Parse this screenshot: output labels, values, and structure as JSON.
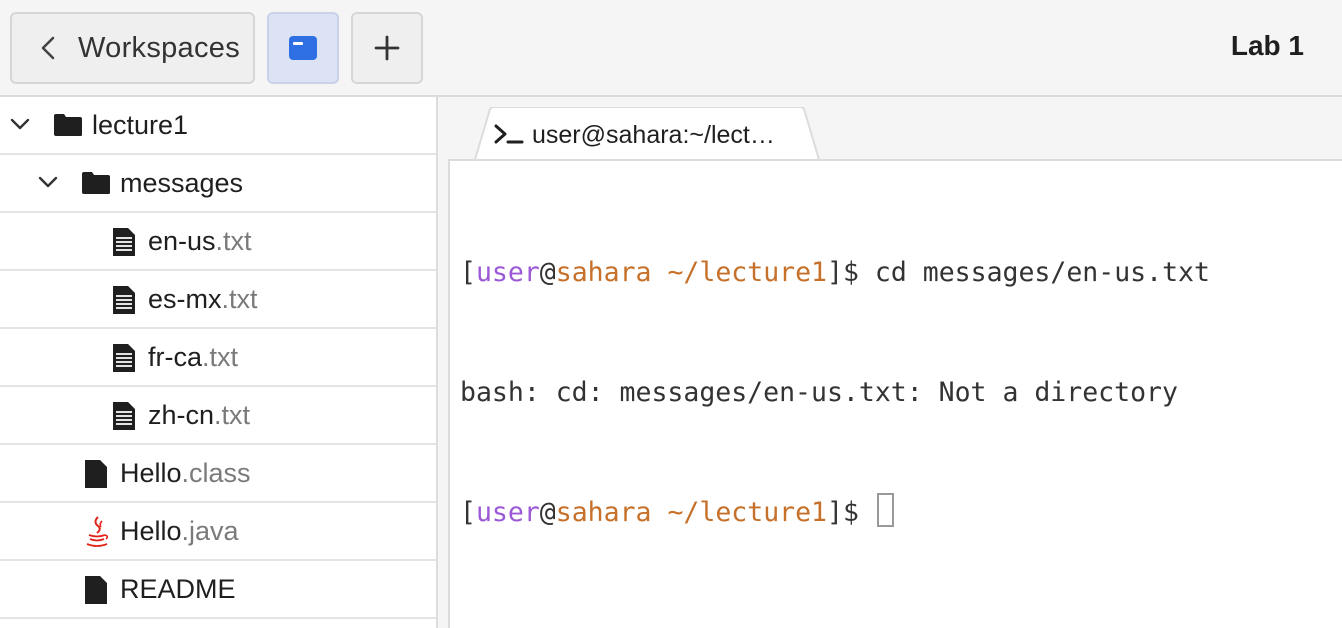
{
  "header": {
    "workspaces_label": "Workspaces",
    "lab_title": "Lab 1"
  },
  "tree": {
    "root": "lecture1",
    "folder": "messages",
    "files_in_folder": [
      {
        "name": "en-us",
        "ext": ".txt"
      },
      {
        "name": "es-mx",
        "ext": ".txt"
      },
      {
        "name": "fr-ca",
        "ext": ".txt"
      },
      {
        "name": "zh-cn",
        "ext": ".txt"
      }
    ],
    "root_files": [
      {
        "name": "Hello",
        "ext": ".class",
        "icon": "file-icon"
      },
      {
        "name": "Hello",
        "ext": ".java",
        "icon": "java-icon"
      },
      {
        "name": "README",
        "ext": "",
        "icon": "file-icon"
      }
    ]
  },
  "terminal": {
    "tab_label": "user@sahara:~/lect…",
    "user": "user",
    "host": "sahara",
    "path": "~/lecture1",
    "command": "cd messages/en-us.txt",
    "output": "bash: cd: messages/en-us.txt: Not a directory",
    "colors": {
      "user": "#9b59d6",
      "host": "#c6702a",
      "path": "#c6702a"
    }
  },
  "icons": [
    "chevron-left-icon",
    "window-icon",
    "plus-icon",
    "chevron-down-icon",
    "folder-icon",
    "text-file-icon",
    "file-icon",
    "java-icon",
    "terminal-prompt-icon"
  ]
}
